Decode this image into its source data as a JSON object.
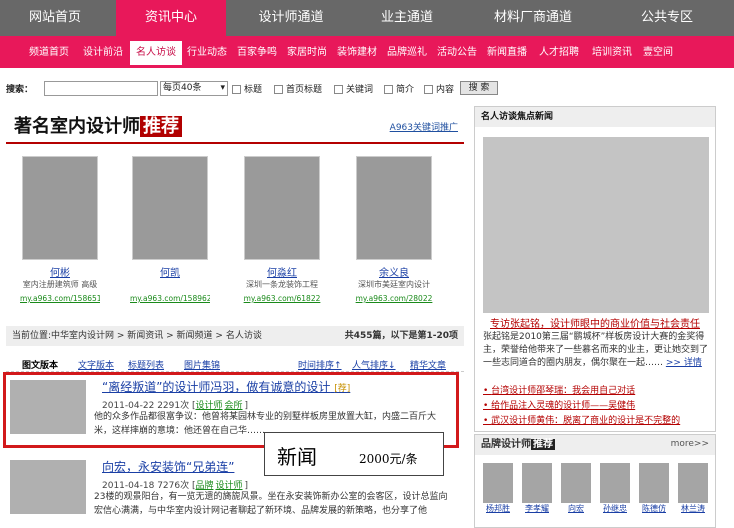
{
  "topnav": [
    "网站首页",
    "资讯中心",
    "设计师通道",
    "业主通道",
    "材料厂商通道",
    "公共专区"
  ],
  "subnav": [
    "频道首页",
    "设计前沿",
    "名人访谈",
    "行业动态",
    "百家争鸣",
    "家居时尚",
    "装饰建材",
    "品牌巡礼",
    "活动公告",
    "新闻直播",
    "人才招聘",
    "培训资讯",
    "壹空间"
  ],
  "search": {
    "label": "搜索：",
    "perpage": "每页40条",
    "opts": [
      "标题",
      "首页标题",
      "关键词",
      "简介",
      "内容"
    ],
    "btn": "搜 索"
  },
  "section": {
    "title": "著名室内设计师",
    "title_hl": "推荐",
    "promo": "A963关键词推广"
  },
  "designers": [
    {
      "name": "何彬",
      "desc": "室内注册建筑师 高级",
      "url": "my.a963.com/158651"
    },
    {
      "name": "何凯",
      "desc": "",
      "url": "my.a963.com/158962"
    },
    {
      "name": "何淼红",
      "desc": "深圳一条龙装饰工程",
      "url": "my.a963.com/61822"
    },
    {
      "name": "余义良",
      "desc": "深圳市美廷室内设计",
      "url": "my.a963.com/28022"
    }
  ],
  "crumb": {
    "text": "当前位置:中华室内设计网 > 新闻资讯 > 新闻频道 > 名人访谈",
    "count": "共455篇，以下是第1-20项"
  },
  "tabs": {
    "a": "图文版本",
    "b": "文字版本",
    "c": "标题列表",
    "d": "图片集锦",
    "s1": "时间排序↑",
    "s2": "人气排序↓",
    "s3": "精华文章"
  },
  "articles": [
    {
      "title": "“离经叛道”的设计师冯羽，做有诚意的设计",
      "badge": "[荐]",
      "date": "2011-04-22",
      "views": "2291次",
      "tags": [
        "设计师",
        "会所"
      ],
      "excerpt": "他的众多作品都很富争议：他曾将某园林专业的别墅样板房里放置大缸，内盛二百斤大米，这样摔崩的意境：他还曾在自己华……"
    },
    {
      "title": "向宏，永安装饰“兄弟连”",
      "badge": "",
      "date": "2011-04-18",
      "views": "7276次",
      "tags": [
        "品牌",
        "设计师"
      ],
      "excerpt": "23楼的观景阳台，有一览无遗的旖旎风景。坐在永安装饰新办公室的会客区，设计总监向宏信心满满，与中华室内设计网记者聊起了新环境、品牌发展的新策略，也分享了他"
    }
  ],
  "callout": {
    "big": "新闻",
    "small": "2000元/条"
  },
  "focus": {
    "head": "名人访谈焦点新闻",
    "title": "专访张起铭，设计师眼中的商业价值与社会责任",
    "excerpt": "张起铭是2010第三届“鹏城杯”样板房设计大赛的金奖得主，荣誉给他带来了一些慕名而来的业主，更让她交到了一些志同道合的圈内朋友，偶尔聚在一起……",
    "more": ">> 详情",
    "links": [
      "台湾设计师邵琴瑞：我会用自己对话",
      "给作品注入灵魂的设计师——吴健伟",
      "武汉设计师黄伟：脱离了商业的设计是不完整的"
    ]
  },
  "brand": {
    "head": "品牌设计师",
    "hl": "推荐",
    "more": "more>>",
    "names": [
      "杨邦胜",
      "李孝耀",
      "向宏",
      "孙继忠",
      "陈德仿",
      "林兰涛"
    ]
  }
}
